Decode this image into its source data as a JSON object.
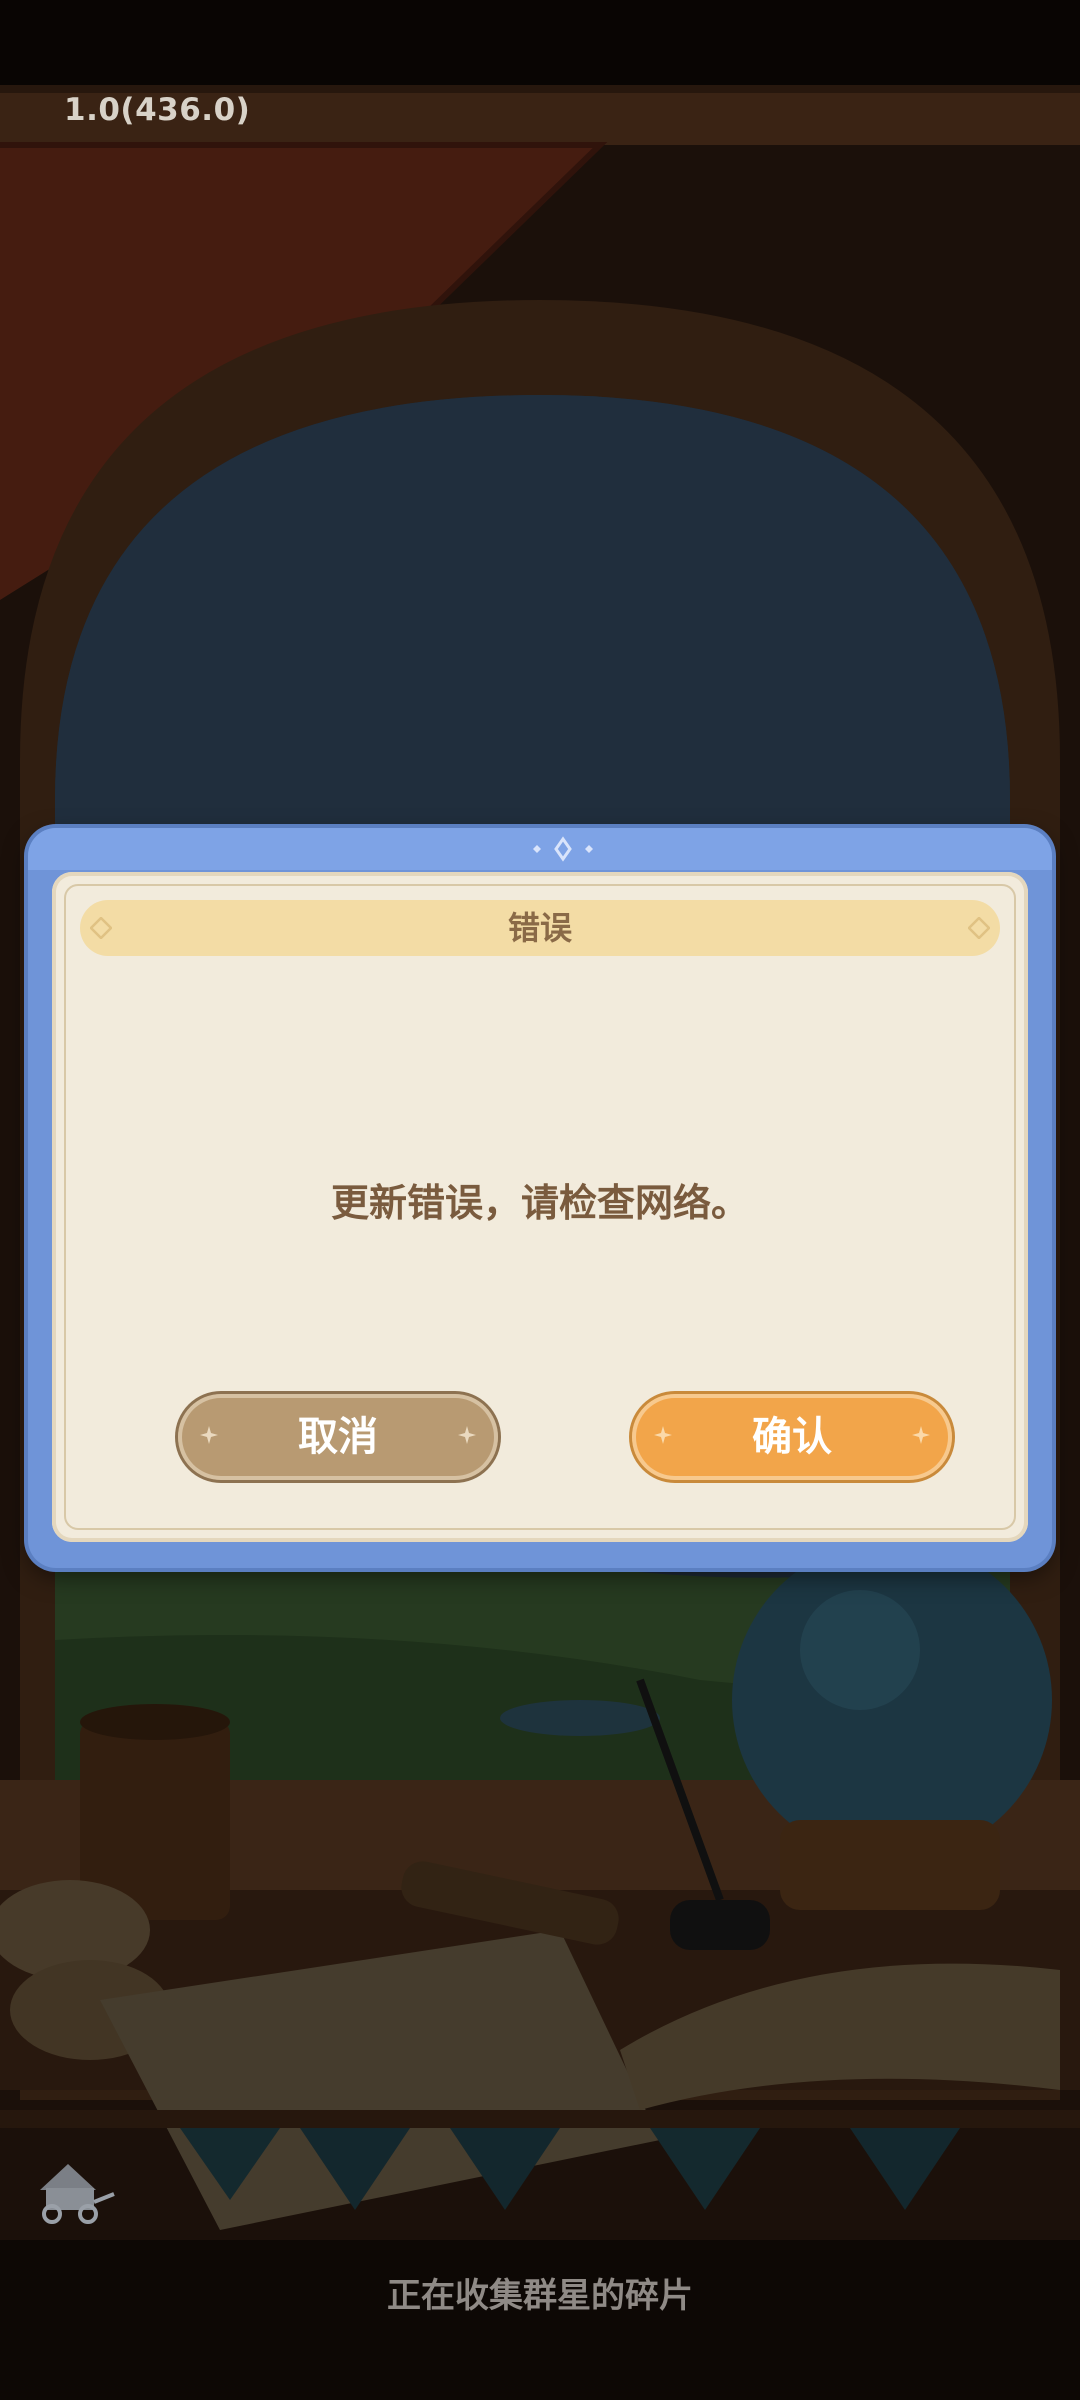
{
  "version": "1.0(436.0)",
  "loading_text": "正在收集群星的碎片",
  "dialog": {
    "title": "错误",
    "message": "更新错误，请检查网络。",
    "cancel_label": "取消",
    "confirm_label": "确认"
  },
  "colors": {
    "frame_blue": "#6f94d8",
    "panel_cream": "#f2ebdc",
    "title_band": "#f3dca5",
    "cancel_button": "#b89a72",
    "confirm_button": "#f2a54a",
    "text_brown": "#7a5b3e"
  }
}
